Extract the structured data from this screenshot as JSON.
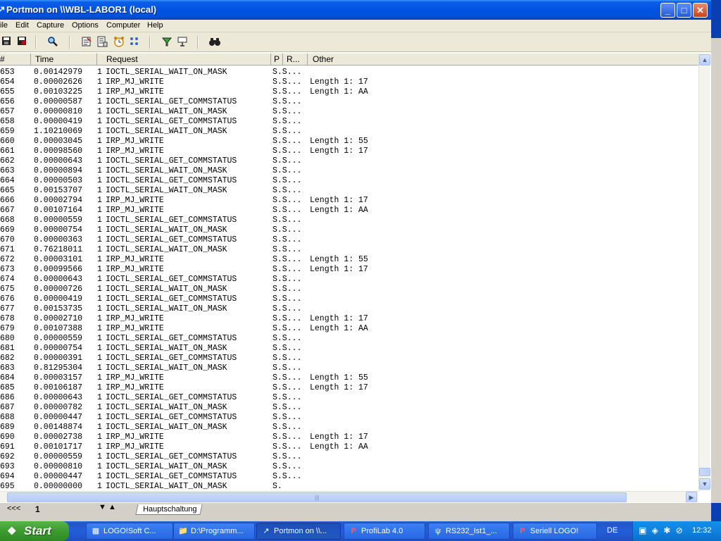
{
  "window": {
    "title": "Portmon on \\\\WBL-LABOR1 (local)",
    "buttons": {
      "minimize": "_",
      "maximize": "□",
      "close": "✕"
    }
  },
  "menu": [
    "ile",
    "Edit",
    "Capture",
    "Options",
    "Computer",
    "Help"
  ],
  "toolbar": {
    "icons": [
      "save-icon",
      "save-as-icon",
      "find-icon",
      "filter-icon",
      "properties-icon",
      "timer-icon",
      "options-icon",
      "highlight-icon",
      "clear-icon",
      "find-binoculars-icon"
    ]
  },
  "columns": [
    "#",
    "Time",
    "Request",
    "P",
    "R...",
    "Other"
  ],
  "log": [
    {
      "n": "653",
      "time": "0.00142979",
      "a": "1",
      "req": "IOCTL_SERIAL_WAIT_ON_MASK",
      "st": "S.S...",
      "other": ""
    },
    {
      "n": "654",
      "time": "0.00002626",
      "a": "1",
      "req": "IRP_MJ_WRITE",
      "st": "S.S...",
      "other": "Length 1: 17"
    },
    {
      "n": "655",
      "time": "0.00103225",
      "a": "1",
      "req": "IRP_MJ_WRITE",
      "st": "S.S...",
      "other": "Length 1: AA"
    },
    {
      "n": "656",
      "time": "0.00000587",
      "a": "1",
      "req": "IOCTL_SERIAL_GET_COMMSTATUS",
      "st": "S.S...",
      "other": ""
    },
    {
      "n": "657",
      "time": "0.00000810",
      "a": "1",
      "req": "IOCTL_SERIAL_WAIT_ON_MASK",
      "st": "S.S...",
      "other": ""
    },
    {
      "n": "658",
      "time": "0.00000419",
      "a": "1",
      "req": "IOCTL_SERIAL_GET_COMMSTATUS",
      "st": "S.S...",
      "other": ""
    },
    {
      "n": "659",
      "time": "1.10210069",
      "a": "1",
      "req": "IOCTL_SERIAL_WAIT_ON_MASK",
      "st": "S.S...",
      "other": ""
    },
    {
      "n": "660",
      "time": "0.00003045",
      "a": "1",
      "req": "IRP_MJ_WRITE",
      "st": "S.S...",
      "other": "Length 1: 55"
    },
    {
      "n": "661",
      "time": "0.00098560",
      "a": "1",
      "req": "IRP_MJ_WRITE",
      "st": "S.S...",
      "other": "Length 1: 17"
    },
    {
      "n": "662",
      "time": "0.00000643",
      "a": "1",
      "req": "IOCTL_SERIAL_GET_COMMSTATUS",
      "st": "S.S...",
      "other": ""
    },
    {
      "n": "663",
      "time": "0.00000894",
      "a": "1",
      "req": "IOCTL_SERIAL_WAIT_ON_MASK",
      "st": "S.S...",
      "other": ""
    },
    {
      "n": "664",
      "time": "0.00000503",
      "a": "1",
      "req": "IOCTL_SERIAL_GET_COMMSTATUS",
      "st": "S.S...",
      "other": ""
    },
    {
      "n": "665",
      "time": "0.00153707",
      "a": "1",
      "req": "IOCTL_SERIAL_WAIT_ON_MASK",
      "st": "S.S...",
      "other": ""
    },
    {
      "n": "666",
      "time": "0.00002794",
      "a": "1",
      "req": "IRP_MJ_WRITE",
      "st": "S.S...",
      "other": "Length 1: 17"
    },
    {
      "n": "667",
      "time": "0.00107164",
      "a": "1",
      "req": "IRP_MJ_WRITE",
      "st": "S.S...",
      "other": "Length 1: AA"
    },
    {
      "n": "668",
      "time": "0.00000559",
      "a": "1",
      "req": "IOCTL_SERIAL_GET_COMMSTATUS",
      "st": "S.S...",
      "other": ""
    },
    {
      "n": "669",
      "time": "0.00000754",
      "a": "1",
      "req": "IOCTL_SERIAL_WAIT_ON_MASK",
      "st": "S.S...",
      "other": ""
    },
    {
      "n": "670",
      "time": "0.00000363",
      "a": "1",
      "req": "IOCTL_SERIAL_GET_COMMSTATUS",
      "st": "S.S...",
      "other": ""
    },
    {
      "n": "671",
      "time": "0.76218011",
      "a": "1",
      "req": "IOCTL_SERIAL_WAIT_ON_MASK",
      "st": "S.S...",
      "other": ""
    },
    {
      "n": "672",
      "time": "0.00003101",
      "a": "1",
      "req": "IRP_MJ_WRITE",
      "st": "S.S...",
      "other": "Length 1: 55"
    },
    {
      "n": "673",
      "time": "0.00099566",
      "a": "1",
      "req": "IRP_MJ_WRITE",
      "st": "S.S...",
      "other": "Length 1: 17"
    },
    {
      "n": "674",
      "time": "0.00000643",
      "a": "1",
      "req": "IOCTL_SERIAL_GET_COMMSTATUS",
      "st": "S.S...",
      "other": ""
    },
    {
      "n": "675",
      "time": "0.00000726",
      "a": "1",
      "req": "IOCTL_SERIAL_WAIT_ON_MASK",
      "st": "S.S...",
      "other": ""
    },
    {
      "n": "676",
      "time": "0.00000419",
      "a": "1",
      "req": "IOCTL_SERIAL_GET_COMMSTATUS",
      "st": "S.S...",
      "other": ""
    },
    {
      "n": "677",
      "time": "0.00153735",
      "a": "1",
      "req": "IOCTL_SERIAL_WAIT_ON_MASK",
      "st": "S.S...",
      "other": ""
    },
    {
      "n": "678",
      "time": "0.00002710",
      "a": "1",
      "req": "IRP_MJ_WRITE",
      "st": "S.S...",
      "other": "Length 1: 17"
    },
    {
      "n": "679",
      "time": "0.00107388",
      "a": "1",
      "req": "IRP_MJ_WRITE",
      "st": "S.S...",
      "other": "Length 1: AA"
    },
    {
      "n": "680",
      "time": "0.00000559",
      "a": "1",
      "req": "IOCTL_SERIAL_GET_COMMSTATUS",
      "st": "S.S...",
      "other": ""
    },
    {
      "n": "681",
      "time": "0.00000754",
      "a": "1",
      "req": "IOCTL_SERIAL_WAIT_ON_MASK",
      "st": "S.S...",
      "other": ""
    },
    {
      "n": "682",
      "time": "0.00000391",
      "a": "1",
      "req": "IOCTL_SERIAL_GET_COMMSTATUS",
      "st": "S.S...",
      "other": ""
    },
    {
      "n": "683",
      "time": "0.81295304",
      "a": "1",
      "req": "IOCTL_SERIAL_WAIT_ON_MASK",
      "st": "S.S...",
      "other": ""
    },
    {
      "n": "684",
      "time": "0.00003157",
      "a": "1",
      "req": "IRP_MJ_WRITE",
      "st": "S.S...",
      "other": "Length 1: 55"
    },
    {
      "n": "685",
      "time": "0.00106187",
      "a": "1",
      "req": "IRP_MJ_WRITE",
      "st": "S.S...",
      "other": "Length 1: 17"
    },
    {
      "n": "686",
      "time": "0.00000643",
      "a": "1",
      "req": "IOCTL_SERIAL_GET_COMMSTATUS",
      "st": "S.S...",
      "other": ""
    },
    {
      "n": "687",
      "time": "0.00000782",
      "a": "1",
      "req": "IOCTL_SERIAL_WAIT_ON_MASK",
      "st": "S.S...",
      "other": ""
    },
    {
      "n": "688",
      "time": "0.00000447",
      "a": "1",
      "req": "IOCTL_SERIAL_GET_COMMSTATUS",
      "st": "S.S...",
      "other": ""
    },
    {
      "n": "689",
      "time": "0.00148874",
      "a": "1",
      "req": "IOCTL_SERIAL_WAIT_ON_MASK",
      "st": "S.S...",
      "other": ""
    },
    {
      "n": "690",
      "time": "0.00002738",
      "a": "1",
      "req": "IRP_MJ_WRITE",
      "st": "S.S...",
      "other": "Length 1: 17"
    },
    {
      "n": "691",
      "time": "0.00101717",
      "a": "1",
      "req": "IRP_MJ_WRITE",
      "st": "S.S...",
      "other": "Length 1: AA"
    },
    {
      "n": "692",
      "time": "0.00000559",
      "a": "1",
      "req": "IOCTL_SERIAL_GET_COMMSTATUS",
      "st": "S.S...",
      "other": ""
    },
    {
      "n": "693",
      "time": "0.00000810",
      "a": "1",
      "req": "IOCTL_SERIAL_WAIT_ON_MASK",
      "st": "S.S...",
      "other": ""
    },
    {
      "n": "694",
      "time": "0.00000447",
      "a": "1",
      "req": "IOCTL_SERIAL_GET_COMMSTATUS",
      "st": "S.S...",
      "other": ""
    },
    {
      "n": "695",
      "time": "0.00000000",
      "a": "1",
      "req": "IOCTL_SERIAL_WAIT_ON_MASK",
      "st": "S.",
      "other": ""
    }
  ],
  "background_app": {
    "nav": "<<<",
    "page": "1",
    "tab": "Hauptschaltung"
  },
  "taskbar": {
    "start": "Start",
    "tasks": [
      {
        "label": "LOGO!Soft C...",
        "icon": "logo-soft-icon",
        "active": false
      },
      {
        "label": "D:\\Programm...",
        "icon": "folder-icon",
        "active": false
      },
      {
        "label": "Portmon on \\\\...",
        "icon": "portmon-icon",
        "active": true
      },
      {
        "label": "ProfiLab 4.0",
        "icon": "profilab-icon",
        "active": false
      },
      {
        "label": "RS232_Ist1_...",
        "icon": "rs232-icon",
        "active": false
      },
      {
        "label": "Seriell LOGO!",
        "icon": "seriell-icon",
        "active": false
      }
    ],
    "language": "DE",
    "clock": "12:32"
  }
}
